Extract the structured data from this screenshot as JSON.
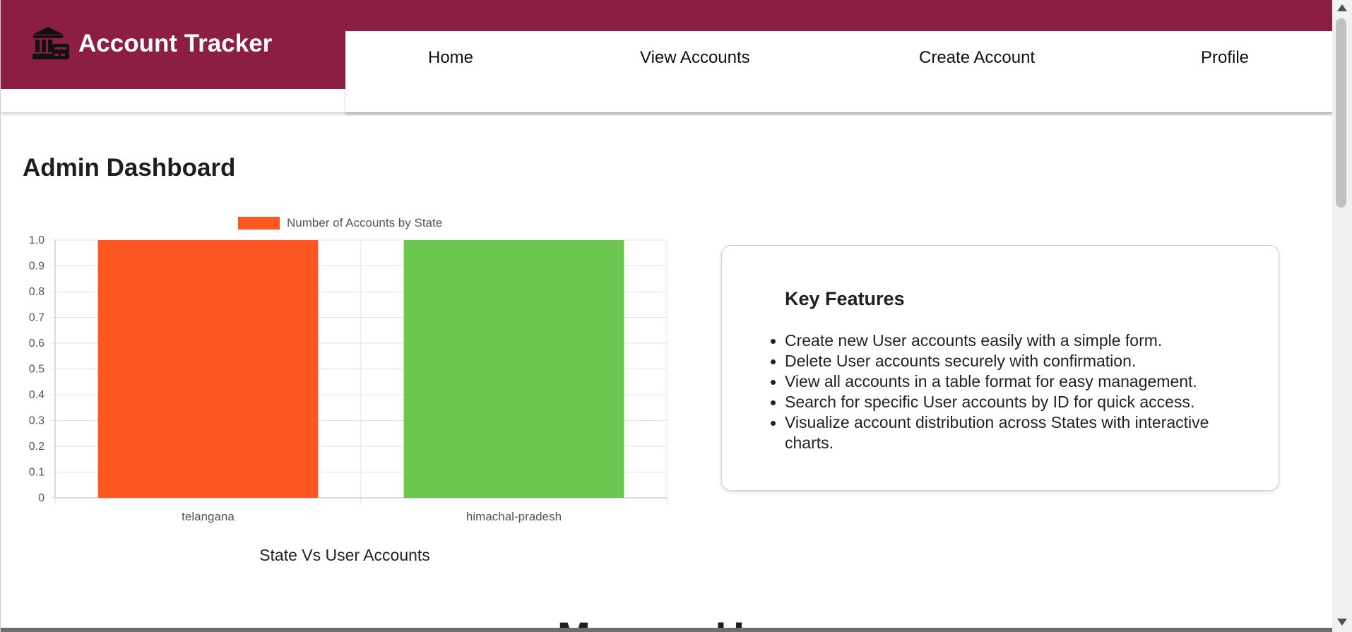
{
  "brand": {
    "title": "Account Tracker",
    "icon": "bank-icon"
  },
  "nav": {
    "items": [
      "Home",
      "View Accounts",
      "Create Account",
      "Profile"
    ]
  },
  "main": {
    "title": "Admin Dashboard",
    "next_heading": "Manage U"
  },
  "chart_data": {
    "type": "bar",
    "categories": [
      "telangana",
      "himachal-pradesh"
    ],
    "series": [
      {
        "name": "Number of Accounts by State",
        "values": [
          1,
          1
        ],
        "colors": [
          "#ff5722",
          "#6cc750"
        ]
      }
    ],
    "ylim": [
      0,
      1.0
    ],
    "yticks": [
      "1.0",
      "0.9",
      "0.8",
      "0.7",
      "0.6",
      "0.5",
      "0.4",
      "0.3",
      "0.2",
      "0.1",
      "0"
    ],
    "grid": true,
    "legend": "top-center",
    "caption": "State Vs User Accounts"
  },
  "features": {
    "title": "Key Features",
    "items": [
      "Create new User accounts easily with a simple form.",
      "Delete User accounts securely with confirmation.",
      "View all accounts in a table format for easy management.",
      "Search for specific User accounts by ID for quick access.",
      "Visualize account distribution across States with interactive charts."
    ]
  },
  "colors": {
    "brand": "#8b1e41",
    "bar_1": "#ff5722",
    "bar_2": "#6cc750"
  }
}
